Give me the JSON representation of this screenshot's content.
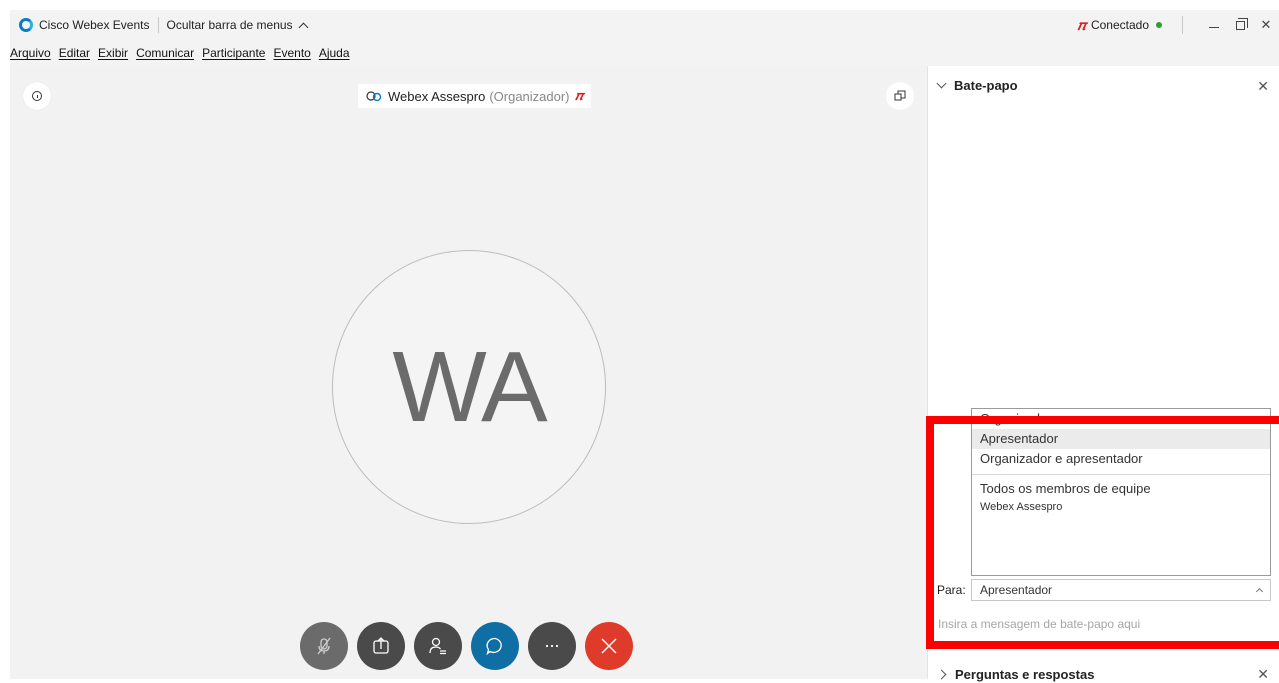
{
  "titlebar": {
    "app_title": "Cisco Webex Events",
    "hide_menu_label": "Ocultar barra de menus",
    "connection_status": "Conectado",
    "status_color": "#2ca02c"
  },
  "menubar": {
    "items": [
      "Arquivo",
      "Editar",
      "Exibir",
      "Comunicar",
      "Participante",
      "Evento",
      "Ajuda"
    ]
  },
  "stage": {
    "speaker_name": "Webex Assespro",
    "speaker_role": "(Organizador)",
    "avatar_initials": "WA"
  },
  "controls": {
    "icons": [
      "mic-muted-icon",
      "share-icon",
      "participants-icon",
      "chat-icon",
      "more-icon",
      "leave-icon"
    ],
    "leave_color": "#de3b2a",
    "chat_color": "#0f6fa5"
  },
  "chat_panel": {
    "title": "Bate-papo",
    "dropdown_options": [
      "Organizador",
      "Apresentador",
      "Organizador e apresentador"
    ],
    "dropdown_group_label": "Todos os membros de equipe",
    "dropdown_member": "Webex Assespro",
    "to_label": "Para:",
    "to_value": "Apresentador",
    "message_placeholder": "Insira a mensagem de bate-papo aqui"
  },
  "qa_panel": {
    "title": "Perguntas e respostas"
  }
}
